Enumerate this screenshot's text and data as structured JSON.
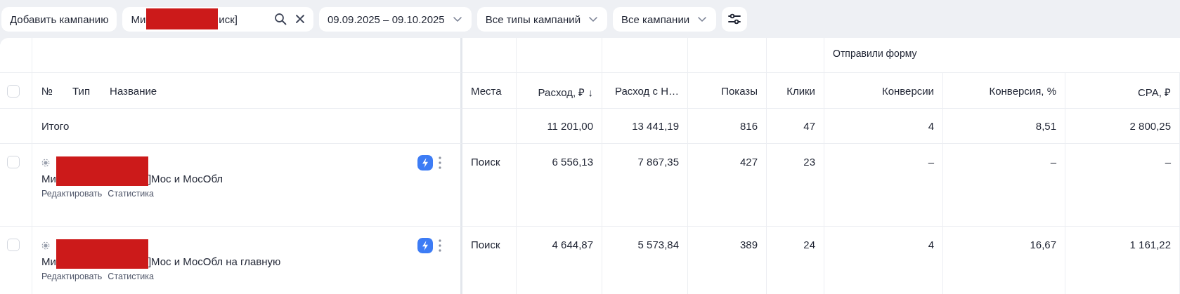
{
  "toolbar": {
    "add_button": "Добавить кампанию",
    "search": {
      "value_start": "Ми",
      "value_end": "иск]"
    },
    "date_range": "09.09.2025 – 09.10.2025",
    "type_filter": "Все типы кампаний",
    "campaign_filter": "Все кампании"
  },
  "table": {
    "group_header": "Отправили форму",
    "select_all": {
      "checked": false
    },
    "name_headers": [
      "№",
      "Тип",
      "Название"
    ],
    "columns": [
      "Места",
      "Расход, ₽ ↓",
      "Расход с Н…",
      "Показы",
      "Клики",
      "Конверсии",
      "Конверсия, %",
      "CPA, ₽"
    ],
    "total": {
      "label": "Итого",
      "values": [
        "11 201,00",
        "13 441,19",
        "816",
        "47",
        "4",
        "8,51",
        "2 800,25"
      ]
    },
    "rows": [
      {
        "checked": false,
        "name_start": "Ми",
        "name_end": "]Мос и МосОбл",
        "actions": [
          "Редактировать",
          "Статистика"
        ],
        "cells": [
          "Поиск",
          "6 556,13",
          "7 867,35",
          "427",
          "23",
          "–",
          "–",
          "–"
        ]
      },
      {
        "checked": false,
        "name_start": "Ми",
        "name_end": "]Мос и МосОбл на главную",
        "actions": [
          "Редактировать",
          "Статистика"
        ],
        "cells": [
          "Поиск",
          "4 644,87",
          "5 573,84",
          "389",
          "24",
          "4",
          "16,67",
          "1 161,22"
        ]
      }
    ]
  }
}
